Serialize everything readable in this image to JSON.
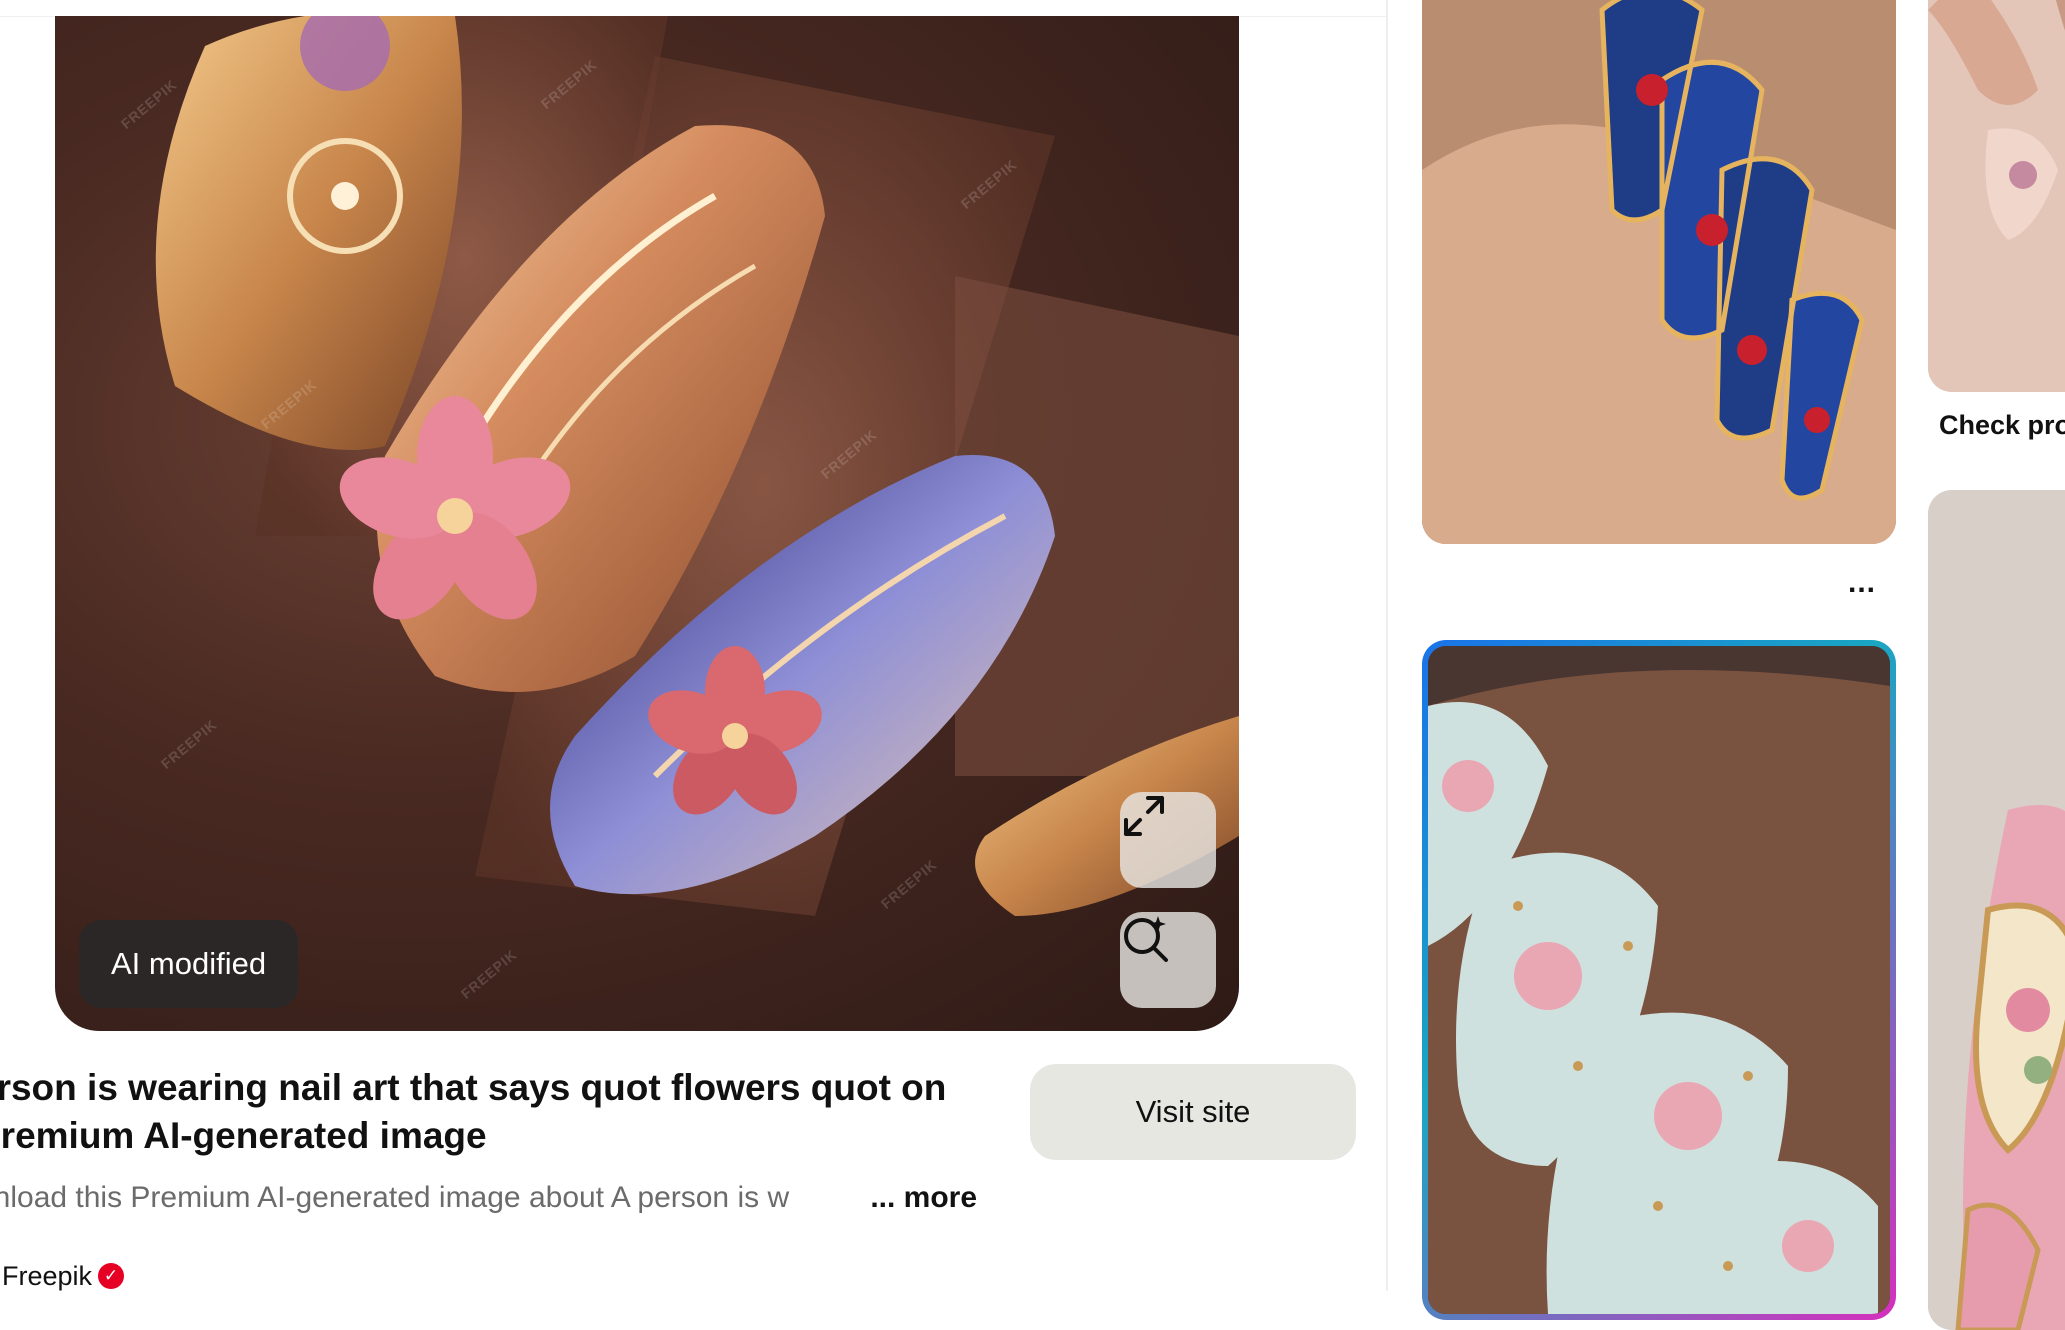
{
  "pin": {
    "ai_badge": "AI modified",
    "expand_label": "Expand image",
    "visual_search_label": "Visual search",
    "title": "erson is wearing nail art that says quot flowers quot on\nPremium AI-generated image",
    "visit_button": "Visit site",
    "description": "wnload this Premium AI-generated image about A person is w",
    "more_link": "... more",
    "source_name": "Freepik",
    "verified_mark": "✓"
  },
  "side": {
    "card1_dots": "...",
    "check_label": "Check pro"
  },
  "colors": {
    "visit_button_bg": "#e7e7e2",
    "ai_badge_bg": "#282828",
    "verified_badge": "#e60023",
    "card_border_gradient": [
      "#1a73e8",
      "#1aa6c2",
      "#d62fbd"
    ]
  },
  "icons": [
    "expand-icon",
    "visual-search-icon",
    "verified-icon",
    "more-options-icon"
  ]
}
